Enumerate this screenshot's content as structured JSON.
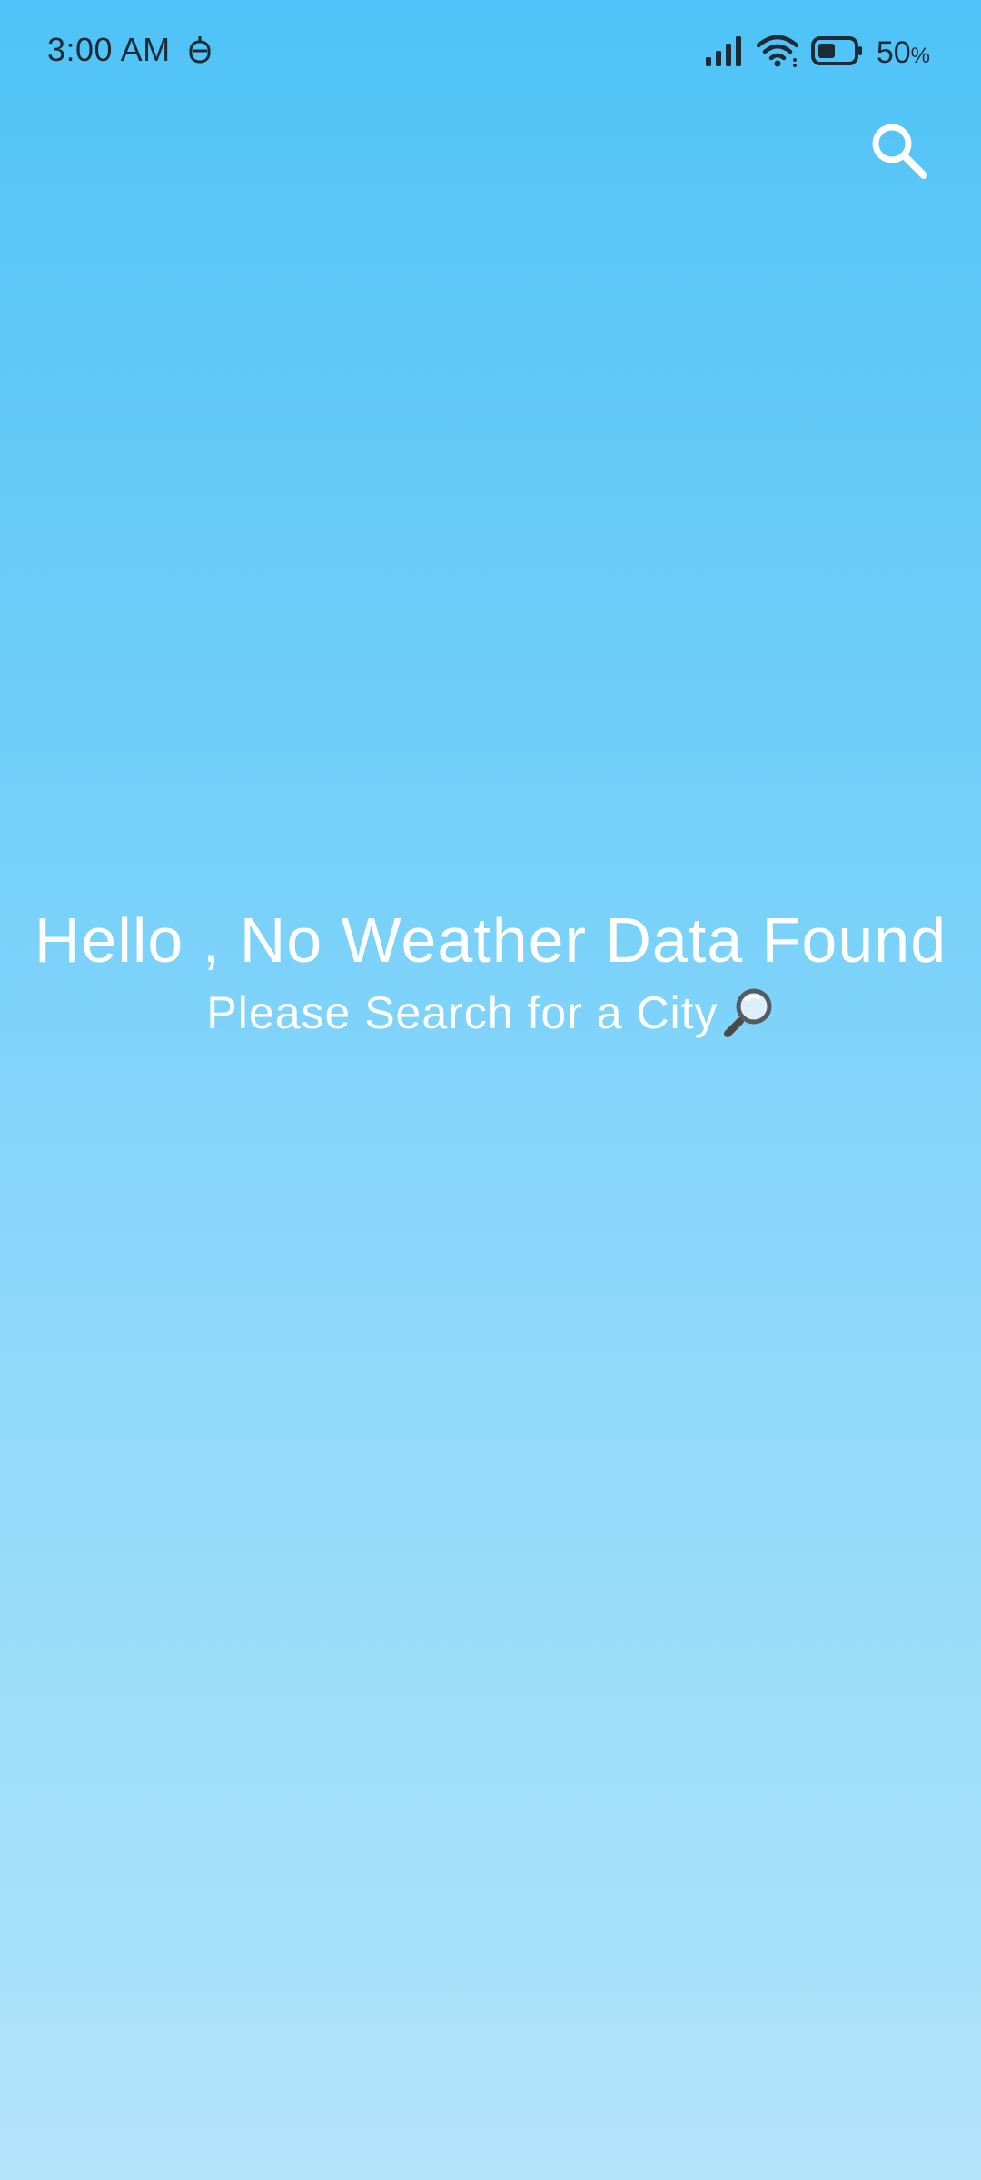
{
  "status_bar": {
    "time": "3:00 AM",
    "battery_percent": "50",
    "battery_unit": "%",
    "battery_level": 0.5,
    "icons": [
      "notification-icon",
      "signal-icon",
      "wifi-icon",
      "battery-icon"
    ]
  },
  "app_bar": {
    "search_icon": "search-icon"
  },
  "empty_state": {
    "title": "Hello , No Weather Data Found",
    "subtitle": "Please Search for a City",
    "subtitle_icon": "magnifier-emoji-icon"
  },
  "colors": {
    "background_top": "#4fc3f7",
    "background_bottom": "#b2e4fa",
    "text": "#ffffff",
    "status_text": "#1d2b36"
  }
}
